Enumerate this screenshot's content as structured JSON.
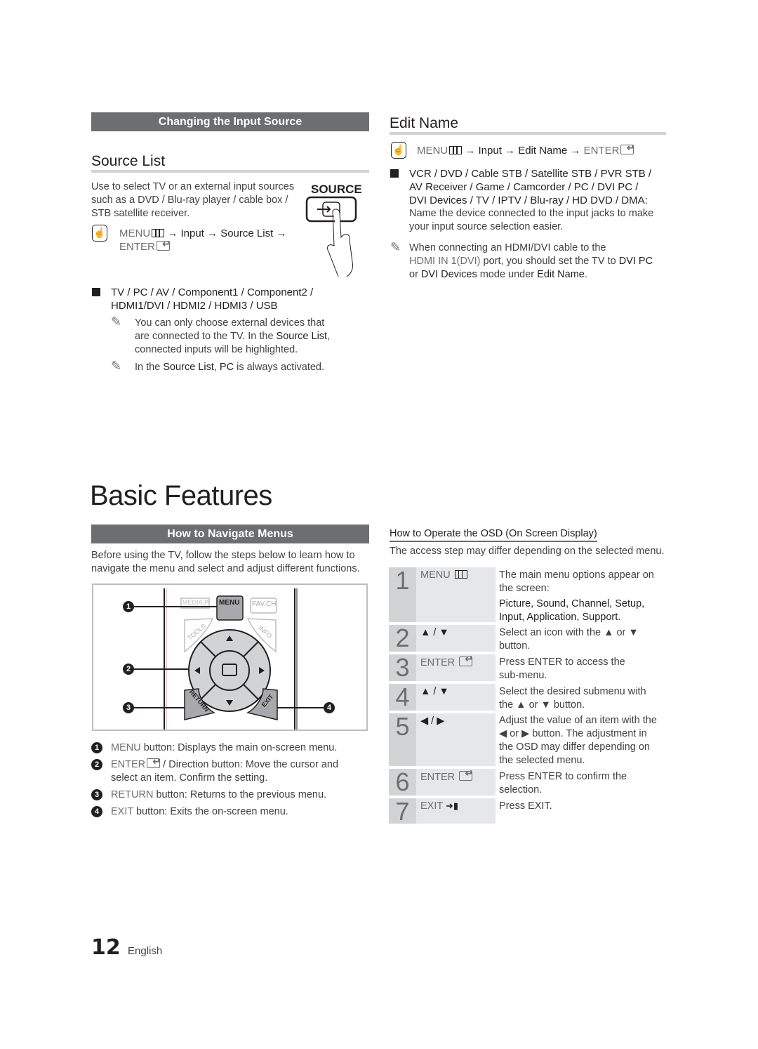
{
  "left": {
    "section_bar": "Changing the Input Source",
    "source_list": {
      "title": "Source List",
      "intro": [
        "Use to select TV or an external input sources",
        "such as a DVD / Blu-ray player / cable box /",
        "STB satellite receiver."
      ],
      "menu_path": {
        "menu": "MENU",
        "rest": " → Input → Source List →",
        "enter": "ENTER"
      },
      "remote_button_label": "SOURCE",
      "options": [
        "TV / PC / AV / Component1 / Component2 /",
        "HDMI1/DVI / HDMI2 / HDMI3 / USB"
      ],
      "note1": {
        "a": "You can only choose external devices that",
        "b": "are connected to the TV. In the ",
        "b_bold": "Source List",
        "b_end": ",",
        "c": "connected inputs will be highlighted."
      },
      "note2": {
        "a": "In the ",
        "bold1": "Source List",
        "mid": ", ",
        "bold2": "PC",
        "end": " is always activated."
      }
    },
    "chapter_title": "Basic Features",
    "navigate": {
      "section_bar": "How to Navigate Menus",
      "intro": [
        "Before using the TV, follow the steps below to learn how to",
        "navigate the menu and select and adjust different functions."
      ],
      "remote": {
        "media": "MEDIA.P",
        "menu": "MENU",
        "favch": "FAV.CH",
        "tools": "TOOLS",
        "info": "INFO",
        "return": "RETURN",
        "exit": "EXIT",
        "callouts": [
          "1",
          "2",
          "3",
          "4"
        ]
      },
      "legend": [
        {
          "num": "1",
          "key": "MENU",
          "text": " button: Displays the main on-screen menu.",
          "cont": ""
        },
        {
          "num": "2",
          "key": "ENTER",
          "text": " / Direction button: Move the cursor and",
          "cont": "select an item. Confirm the setting."
        },
        {
          "num": "3",
          "key": "RETURN",
          "text": " button: Returns to the previous menu.",
          "cont": ""
        },
        {
          "num": "4",
          "key": "EXIT",
          "text": " button: Exits the on-screen menu.",
          "cont": ""
        }
      ]
    }
  },
  "right": {
    "edit_name": {
      "title": "Edit Name",
      "menu_path": {
        "menu": "MENU",
        "rest": " → Input → Edit Name → ",
        "enter": "ENTER"
      },
      "devices": [
        "VCR / DVD / Cable STB / Satellite STB / PVR STB /",
        "AV Receiver / Game / Camcorder / PC / DVI PC /",
        "DVI Devices / TV / IPTV / Blu-ray / HD DVD / DMA"
      ],
      "devices_desc": [
        "Name the device connected to the input jacks to make",
        "your input source selection easier."
      ],
      "note": {
        "a": "When connecting an HDMI/DVI cable to the",
        "port": "HDMI IN 1(DVI)",
        "b": " port, you should set the TV to ",
        "b_bold": "DVI PC",
        "c": "or ",
        "c_bold": "DVI Devices",
        "c_mid": " mode under ",
        "c_bold2": "Edit Name",
        "c_end": "."
      }
    },
    "osd": {
      "title": "How to Operate the OSD (On Screen Display)",
      "subtitle": "The access step may differ depending on the selected menu.",
      "steps": [
        {
          "num": "1",
          "key": "MENU",
          "desc": [
            "The main menu options appear on",
            "the screen:"
          ],
          "bold": [
            "Picture, Sound, Channel, Setup,",
            "Input, Application, Support."
          ]
        },
        {
          "num": "2",
          "key": "▲ / ▼",
          "desc": [
            "Select an icon with the ▲ or ▼",
            "button."
          ]
        },
        {
          "num": "3",
          "key": "ENTER",
          "desc": [
            "Press ENTER to access the",
            "sub-menu."
          ]
        },
        {
          "num": "4",
          "key": "▲ / ▼",
          "desc": [
            "Select the desired submenu with",
            "the ▲ or ▼ button."
          ]
        },
        {
          "num": "5",
          "key": "◀ / ▶",
          "desc": [
            "Adjust the value of an item with the",
            "◀ or ▶ button. The adjustment in",
            "the OSD may differ depending on",
            "the selected menu."
          ]
        },
        {
          "num": "6",
          "key": "ENTER",
          "desc": [
            "Press ENTER to confirm the",
            "selection."
          ]
        },
        {
          "num": "7",
          "key": "EXIT",
          "desc": [
            "Press EXIT."
          ]
        }
      ]
    }
  },
  "footer": {
    "page_number": "12",
    "language": "English"
  }
}
